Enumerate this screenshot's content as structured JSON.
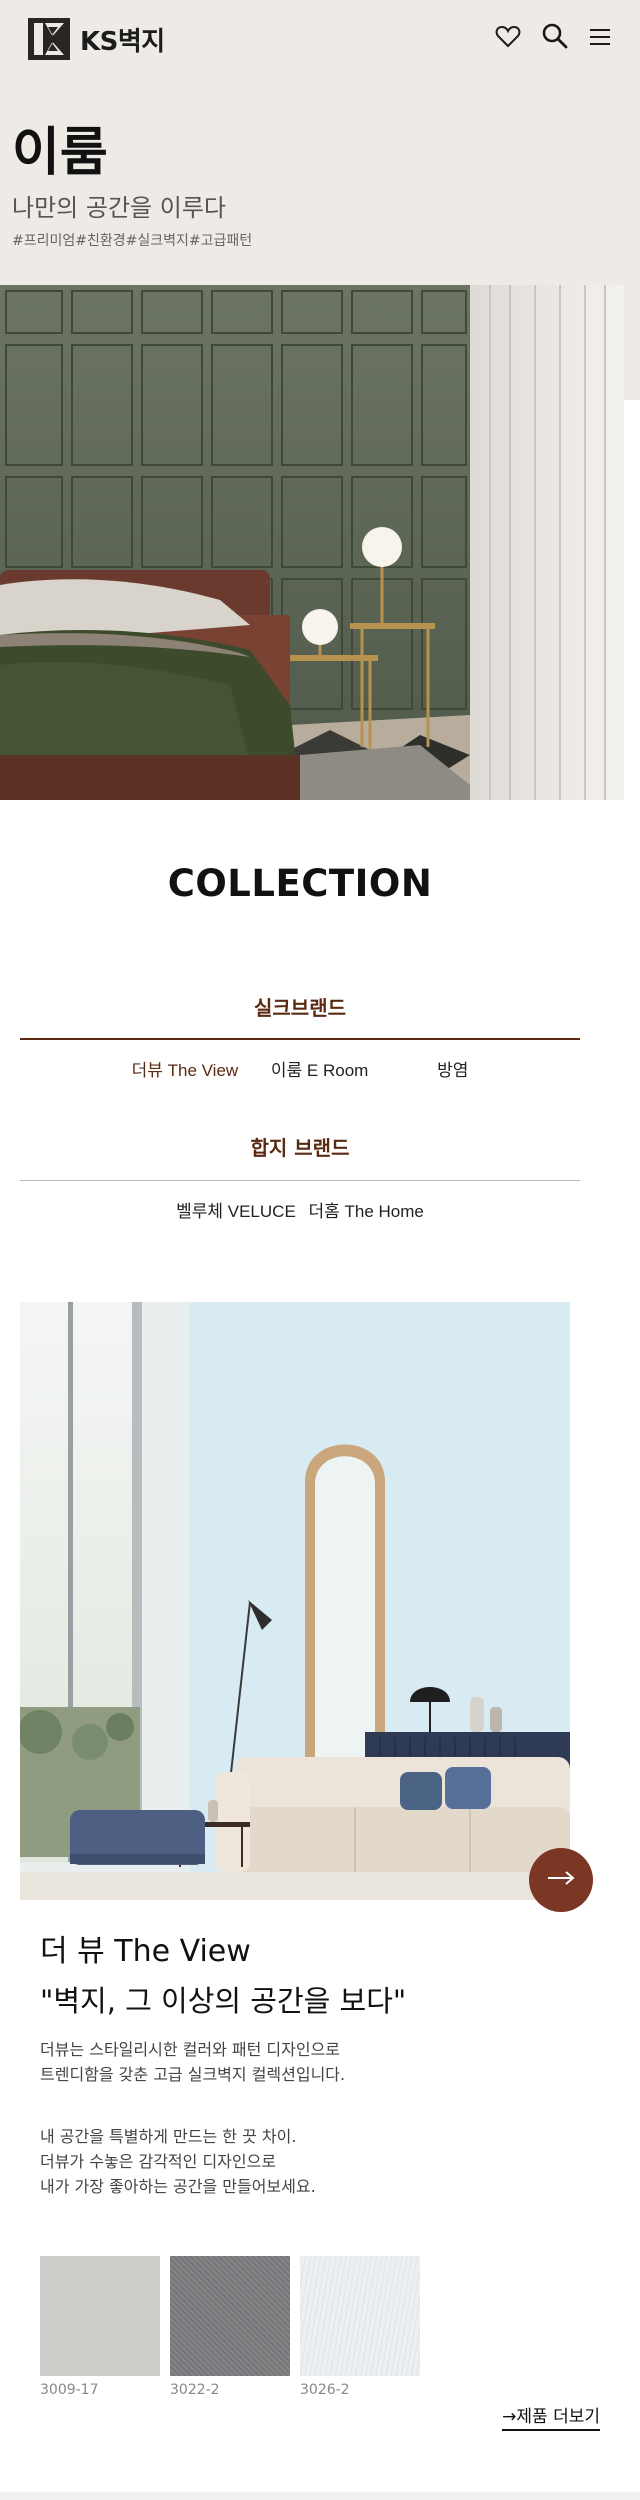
{
  "header": {
    "logo_text": "KS벽지",
    "icons": [
      "heart-icon",
      "search-icon",
      "menu-icon"
    ]
  },
  "hero": {
    "title": "이룸",
    "subtitle": "나만의 공간을 이루다",
    "tags": "#프리미엄#친환경#실크벽지#고급패턴"
  },
  "collection": {
    "title": "COLLECTION",
    "silk_brand": {
      "heading": "실크브랜드",
      "items": [
        "더뷰 The View",
        "이룸 E Room",
        "방염"
      ]
    },
    "paper_brand": {
      "heading": "합지 브랜드",
      "items": [
        "벨루체 VELUCE",
        "더홈 The Home"
      ]
    }
  },
  "product": {
    "name": "더 뷰 The View",
    "quote": "\"벽지, 그 이상의 공간을 보다\"",
    "desc1_line1": "더뷰는 스타일리시한 컬러와 패턴 디자인으로",
    "desc1_line2": "트렌디함을 갖춘 고급 실크벽지 컬렉션입니다.",
    "desc2_line1": "내 공간을 특별하게 만드는 한 끗 차이.",
    "desc2_line2": "더뷰가 수놓은 감각적인 디자인으로",
    "desc2_line3": "내가 가장 좋아하는 공간을 만들어보세요.",
    "swatches": [
      {
        "code": "3009-17",
        "color": "#cfcdc9"
      },
      {
        "code": "3022-2",
        "color": "#7c7d80"
      },
      {
        "code": "3026-2",
        "color": "#eceff3"
      }
    ],
    "more_label": "→제품 더보기"
  },
  "colors": {
    "accent": "#7b3624",
    "brand_text": "#5a2b12",
    "hero_bg": "#eeebe6"
  }
}
